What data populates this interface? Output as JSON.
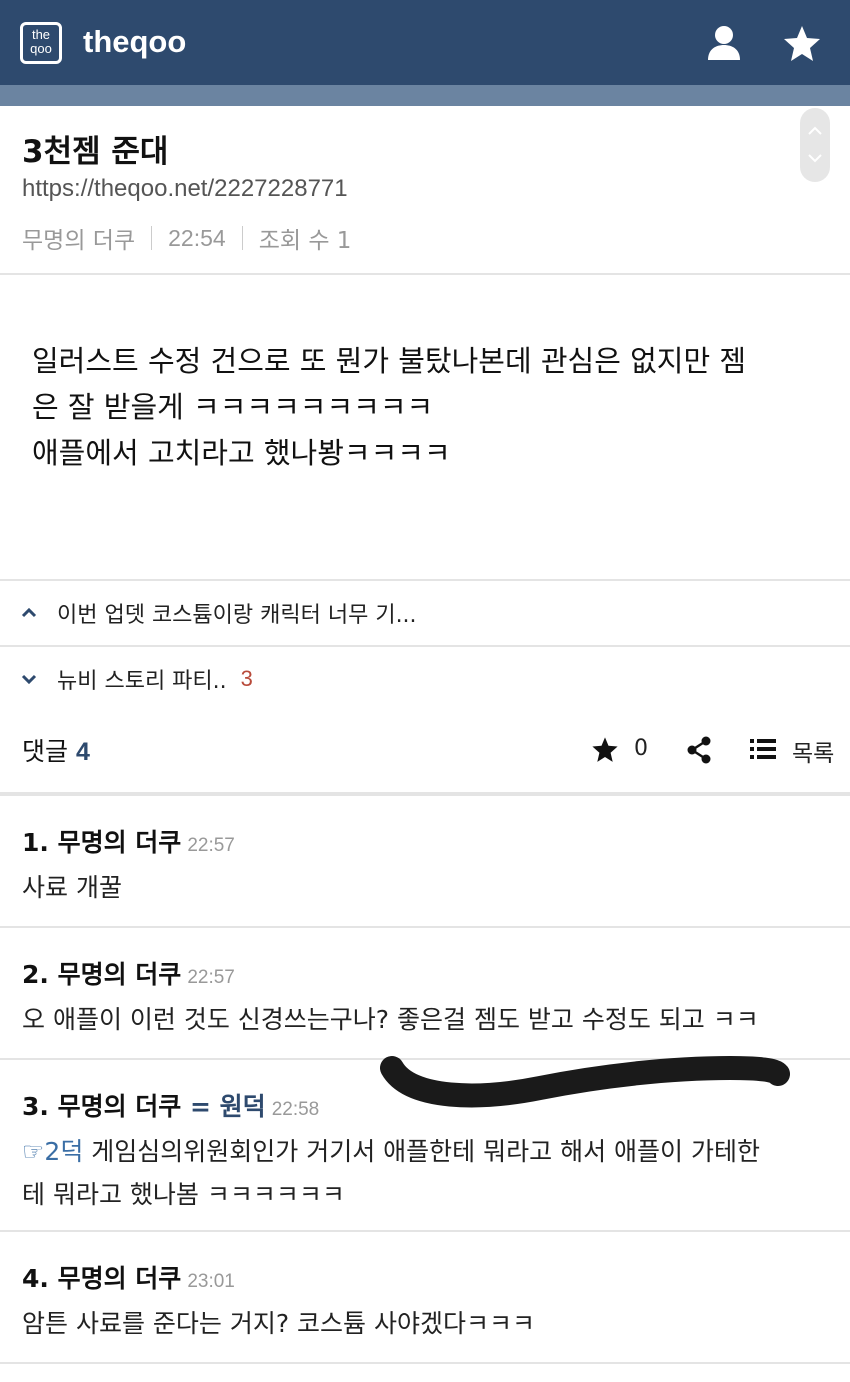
{
  "header": {
    "logo_small_top": "the",
    "logo_small_bottom": "qoo",
    "site_name": "theqoo",
    "icons": [
      "user-icon",
      "star-icon"
    ]
  },
  "post": {
    "title": "3천젬 준대",
    "url": "https://theqoo.net/2227228771",
    "author": "무명의 더쿠",
    "time": "22:54",
    "views": "조회 수 1",
    "body_lines": [
      "일러스트 수정 건으로 또 뭔가 불탔나본데 관심은 없지만 젬",
      "은 잘 받을게 ㅋㅋㅋㅋㅋㅋㅋㅋㅋ",
      "애플에서 고치라고 했나봥ㅋㅋㅋㅋ"
    ]
  },
  "nav": {
    "prev": {
      "label": "이번 업뎃 코스튬이랑 캐릭터 너무 기...",
      "icon": "chevron-up-icon"
    },
    "next": {
      "label": "뉴비 스토리 파티..",
      "count": "3",
      "icon": "chevron-down-icon"
    }
  },
  "comment_bar": {
    "label": "댓글",
    "count": "4",
    "star_count": "0",
    "list_label": "목록"
  },
  "comments": [
    {
      "head": "1. 무명의 더쿠",
      "time": "22:57",
      "lines": [
        "사료 개꿀"
      ]
    },
    {
      "head": "2. 무명의 더쿠",
      "time": "22:57",
      "lines": [
        "오 애플이 이런 것도 신경쓰는구나? 좋은걸 젬도 받고 수정도 되고 ㅋㅋ"
      ]
    },
    {
      "head": "3. 무명의 더쿠",
      "tag": "= 원덕",
      "time": "22:58",
      "reply_ref": "☞2덕",
      "lines": [
        " 게임심의위원회인가 거기서 애플한테 뭐라고 해서 애플이 가테한",
        "테 뭐라고 했나봄 ㅋㅋㅋㅋㅋㅋ"
      ]
    },
    {
      "head": "4. 무명의 더쿠",
      "time": "23:01",
      "lines": [
        "암튼 사료를 준다는 거지? 코스튬 사야겠다ㅋㅋㅋ"
      ]
    }
  ],
  "colors": {
    "header_bg": "#2e4a6e",
    "subbar_bg": "#6b84a1",
    "count_red": "#b84a3a",
    "link_blue": "#3a6ea5"
  }
}
